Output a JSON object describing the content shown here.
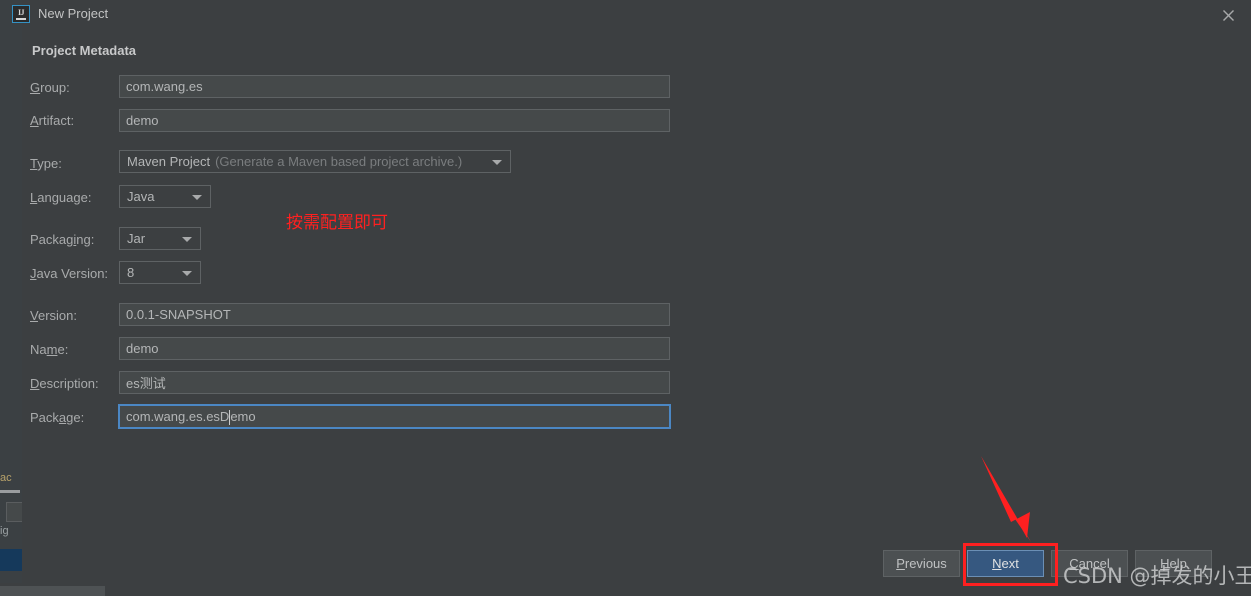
{
  "window": {
    "title": "New Project",
    "logo_icon": "intellij-idea-logo",
    "logo_text": "IJ",
    "close_icon": "close-icon"
  },
  "section": {
    "title": "Project Metadata"
  },
  "fields": {
    "group": {
      "label_pre": "",
      "label_mnemonic": "G",
      "label_post": "roup:",
      "value": "com.wang.es"
    },
    "artifact": {
      "label_pre": "",
      "label_mnemonic": "A",
      "label_post": "rtifact:",
      "value": "demo"
    },
    "type": {
      "label_pre": "",
      "label_mnemonic": "T",
      "label_post": "ype:",
      "value": "Maven Project",
      "hint": "(Generate a Maven based project archive.)"
    },
    "language": {
      "label_pre": "",
      "label_mnemonic": "L",
      "label_post": "anguage:",
      "value": "Java"
    },
    "packaging": {
      "label_pre": "Packag",
      "label_mnemonic": "i",
      "label_post": "ng:",
      "value": "Jar"
    },
    "java_version": {
      "label_pre": "",
      "label_mnemonic": "J",
      "label_post": "ava Version:",
      "value": "8"
    },
    "version": {
      "label_pre": "",
      "label_mnemonic": "V",
      "label_post": "ersion:",
      "value": "0.0.1-SNAPSHOT"
    },
    "name": {
      "label_pre": "Na",
      "label_mnemonic": "m",
      "label_post": "e:",
      "value": "demo"
    },
    "description": {
      "label_pre": "",
      "label_mnemonic": "D",
      "label_post": "escription:",
      "value": "es测试"
    },
    "package": {
      "label_pre": "Pack",
      "label_mnemonic": "a",
      "label_post": "ge:",
      "value_before_caret": "com.wang.es.esD",
      "value_after_caret": "emo",
      "focused": true
    }
  },
  "buttons": {
    "previous": {
      "pre": "",
      "mnemonic": "P",
      "post": "revious"
    },
    "next": {
      "pre": "",
      "mnemonic": "N",
      "post": "ext"
    },
    "cancel": {
      "pre": "",
      "mnemonic": "C",
      "post": "ancel"
    },
    "help": {
      "pre": "",
      "mnemonic": "H",
      "post": "elp"
    }
  },
  "annotations": {
    "chinese_note": "按需配置即可",
    "arrow_icon": "red-arrow-down-icon",
    "highlight_color": "#ff2020"
  },
  "watermark": {
    "text": "CSDN @掉发的小王"
  },
  "background_ide": {
    "text_top": "ac",
    "text_mid": "ig"
  },
  "colors": {
    "dialog_bg": "#3c3f41",
    "field_bg": "#45494a",
    "field_border": "#5e6264",
    "focus_border": "#4b87c4",
    "primary_button": "#365880",
    "text": "#a9abac",
    "accent_red": "#ff2020"
  }
}
